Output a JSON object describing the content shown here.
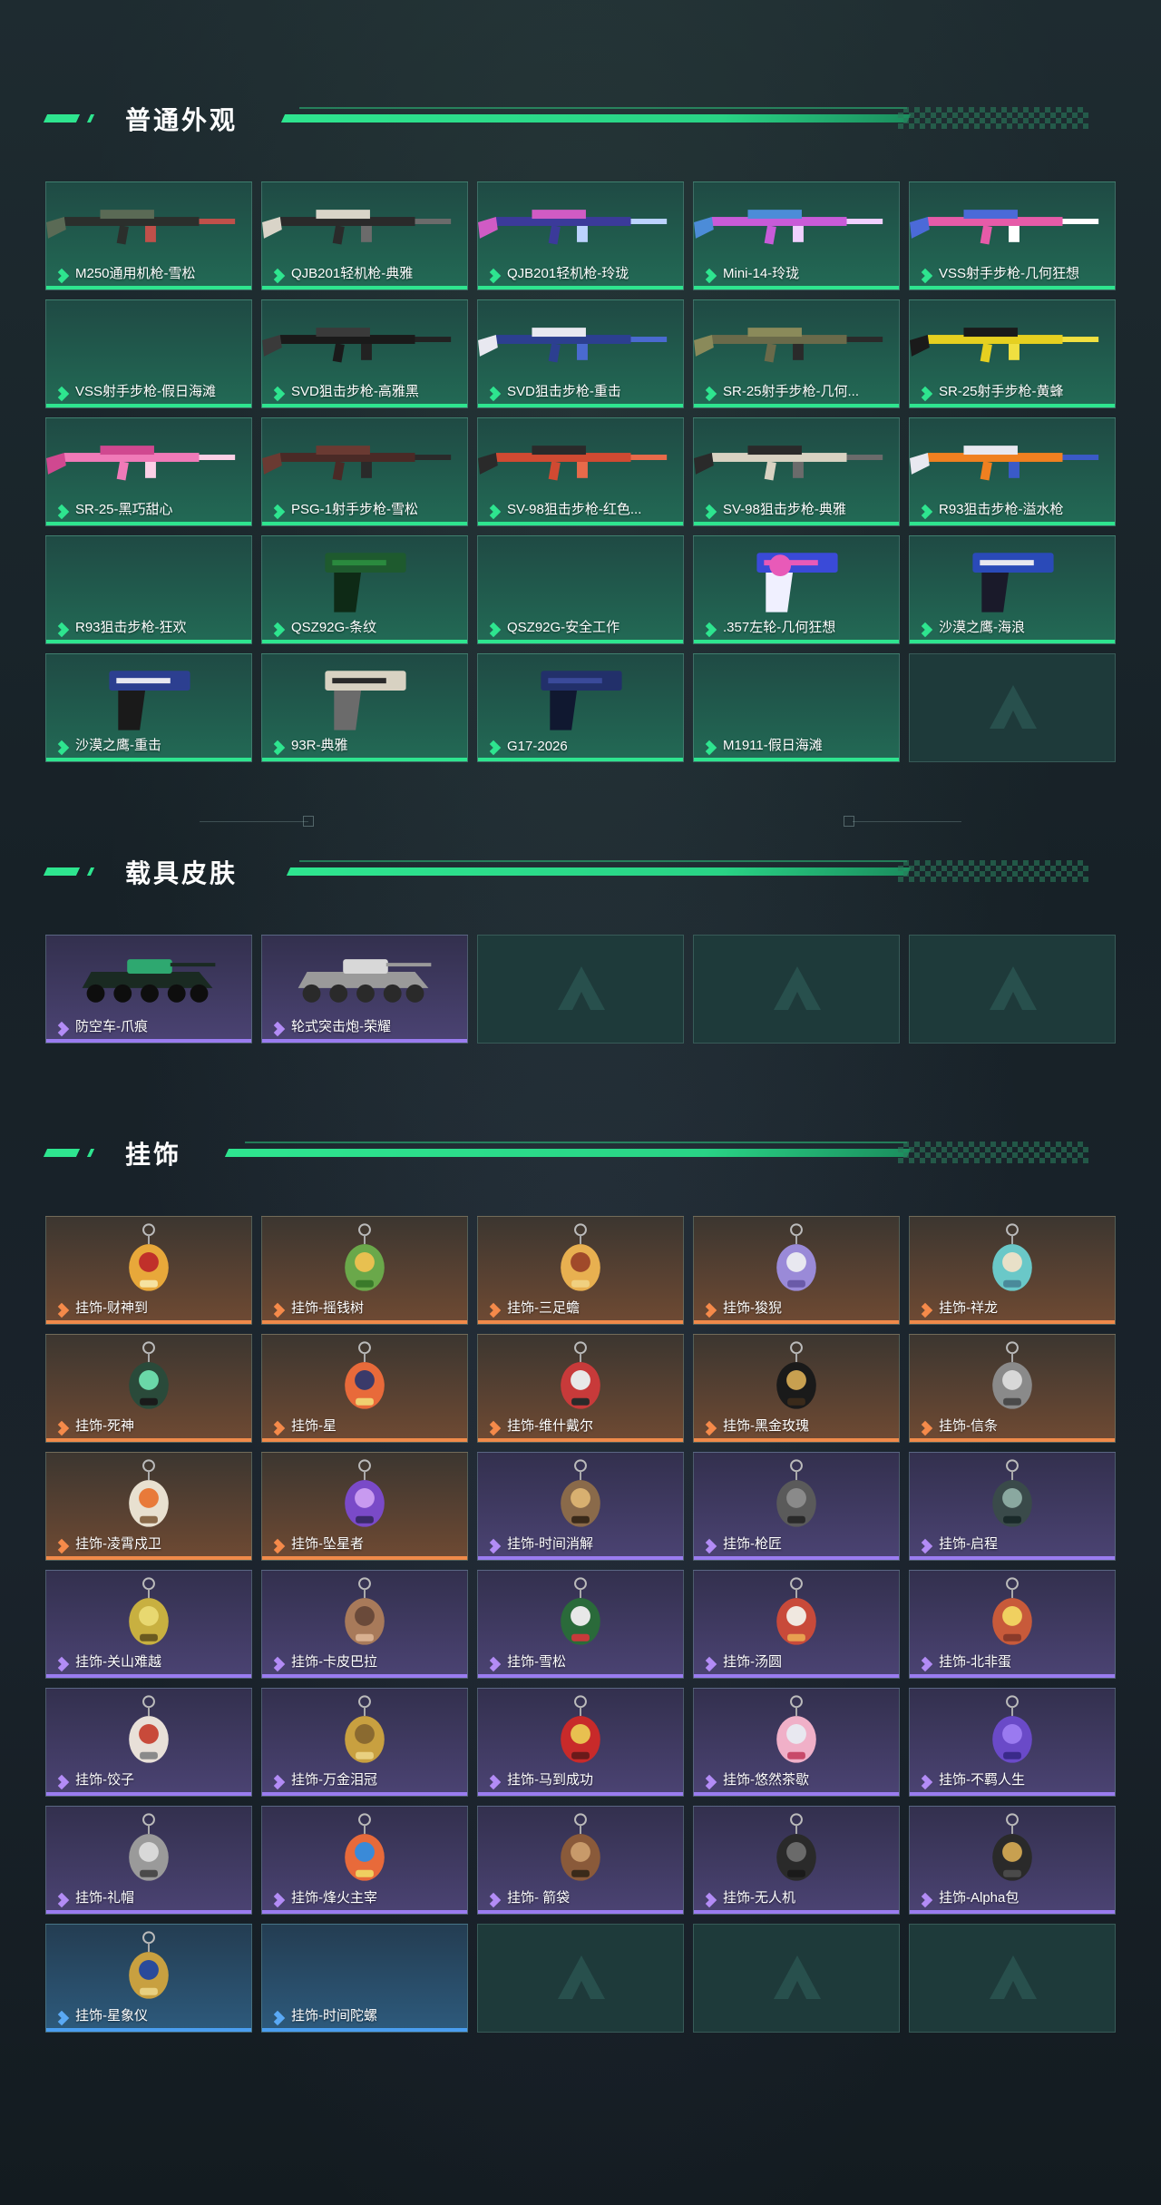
{
  "sections": [
    {
      "title": "普通外观",
      "items": [
        {
          "label": "M250通用机枪-雪松",
          "rarity": "green",
          "art": "rifle",
          "colors": [
            "#2b2f2c",
            "#5a6a55",
            "#c0504a"
          ]
        },
        {
          "label": "QJB201轻机枪-典雅",
          "rarity": "green",
          "art": "rifle",
          "colors": [
            "#2a2a2a",
            "#d9d4c8",
            "#6b6b6b"
          ]
        },
        {
          "label": "QJB201轻机枪-玲珑",
          "rarity": "green",
          "art": "rifle",
          "colors": [
            "#3b3a9a",
            "#d05bc4",
            "#bcd3ff"
          ]
        },
        {
          "label": "Mini-14-玲珑",
          "rarity": "green",
          "art": "rifle",
          "colors": [
            "#c85bd8",
            "#4c8cd8",
            "#f0d0ff"
          ]
        },
        {
          "label": "VSS射手步枪-几何狂想",
          "rarity": "green",
          "art": "rifle",
          "colors": [
            "#e65ba8",
            "#4b6ad8",
            "#ffffff"
          ]
        },
        {
          "label": "VSS射手步枪-假日海滩",
          "rarity": "green",
          "art": "none",
          "colors": [
            "#1f4a44",
            "#1f4a44",
            "#1f4a44"
          ]
        },
        {
          "label": "SVD狙击步枪-高雅黑",
          "rarity": "green",
          "art": "rifle",
          "colors": [
            "#1a1a1a",
            "#3a3a3a",
            "#222"
          ]
        },
        {
          "label": "SVD狙击步枪-重击",
          "rarity": "green",
          "art": "rifle",
          "colors": [
            "#2c3f90",
            "#e8e8f0",
            "#4a6ad0"
          ]
        },
        {
          "label": "SR-25射手步枪-几何...",
          "rarity": "green",
          "art": "rifle",
          "colors": [
            "#6a6a4a",
            "#8a8a5a",
            "#2a2a2a"
          ]
        },
        {
          "label": "SR-25射手步枪-黄蜂",
          "rarity": "green",
          "art": "rifle",
          "colors": [
            "#e6d020",
            "#1a1a1a",
            "#f0e040"
          ]
        },
        {
          "label": "SR-25-黑巧甜心",
          "rarity": "green",
          "art": "rifle",
          "colors": [
            "#f07ab8",
            "#d04890",
            "#fbd0e6"
          ]
        },
        {
          "label": "PSG-1射手步枪-雪松",
          "rarity": "green",
          "art": "rifle",
          "colors": [
            "#4a2a26",
            "#6a3a32",
            "#2a2a2a"
          ]
        },
        {
          "label": "SV-98狙击步枪-红色...",
          "rarity": "green",
          "art": "rifle",
          "colors": [
            "#d04a32",
            "#2a2a2a",
            "#e86a4a"
          ]
        },
        {
          "label": "SV-98狙击步枪-典雅",
          "rarity": "green",
          "art": "rifle",
          "colors": [
            "#d8d2c2",
            "#2a2a2a",
            "#6b6b6b"
          ]
        },
        {
          "label": "R93狙击步枪-溢水枪",
          "rarity": "green",
          "art": "rifle",
          "colors": [
            "#f08020",
            "#e8e8f0",
            "#3a5ac8"
          ]
        },
        {
          "label": "R93狙击步枪-狂欢",
          "rarity": "green",
          "art": "none",
          "colors": [
            "#1f4a44",
            "#1f4a44",
            "#1f4a44"
          ]
        },
        {
          "label": "QSZ92G-条纹",
          "rarity": "green",
          "art": "pistol",
          "colors": [
            "#1e5a2e",
            "#2a8a3e",
            "#0e2a16"
          ]
        },
        {
          "label": "QSZ92G-安全工作",
          "rarity": "green",
          "art": "none",
          "colors": [
            "#1f4a44",
            "#1f4a44",
            "#1f4a44"
          ]
        },
        {
          "label": ".357左轮-几何狂想",
          "rarity": "green",
          "art": "revolver",
          "colors": [
            "#3a4ad8",
            "#e85ab8",
            "#f0f0ff"
          ]
        },
        {
          "label": "沙漠之鹰-海浪",
          "rarity": "green",
          "art": "pistol",
          "colors": [
            "#2a4ab8",
            "#e8e8f0",
            "#1a1a2a"
          ]
        },
        {
          "label": "沙漠之鹰-重击",
          "rarity": "green",
          "art": "pistol",
          "colors": [
            "#2c3f90",
            "#e8e8f0",
            "#1a1a1a"
          ]
        },
        {
          "label": "93R-典雅",
          "rarity": "green",
          "art": "pistol",
          "colors": [
            "#d8d2c2",
            "#2a2a2a",
            "#6b6b6b"
          ]
        },
        {
          "label": "G17-2026",
          "rarity": "green",
          "art": "pistol",
          "colors": [
            "#22306a",
            "#3a4a9a",
            "#101830"
          ]
        },
        {
          "label": "M1911-假日海滩",
          "rarity": "green",
          "art": "none",
          "colors": [
            "#1f4a44",
            "#1f4a44",
            "#1f4a44"
          ]
        },
        {
          "label": "",
          "rarity": "empty",
          "art": "logo",
          "colors": [
            "#3a6a66",
            "#3a6a66",
            "#3a6a66"
          ]
        }
      ]
    },
    {
      "title": "载具皮肤",
      "items": [
        {
          "label": "防空车-爪痕",
          "rarity": "purple",
          "art": "vehicle",
          "colors": [
            "#1a2a22",
            "#2ea870",
            "#0e0e0e"
          ]
        },
        {
          "label": "轮式突击炮-荣耀",
          "rarity": "purple",
          "art": "vehicle",
          "colors": [
            "#9a9a9a",
            "#d8d8d8",
            "#2a2a2a"
          ]
        },
        {
          "label": "",
          "rarity": "empty",
          "art": "logo",
          "colors": [
            "#3a6a66",
            "#3a6a66",
            "#3a6a66"
          ]
        },
        {
          "label": "",
          "rarity": "empty",
          "art": "logo",
          "colors": [
            "#3a6a66",
            "#3a6a66",
            "#3a6a66"
          ]
        },
        {
          "label": "",
          "rarity": "empty",
          "art": "logo",
          "colors": [
            "#3a6a66",
            "#3a6a66",
            "#3a6a66"
          ]
        }
      ]
    },
    {
      "title": "挂饰",
      "items": [
        {
          "label": "挂饰-财神到",
          "rarity": "orange",
          "art": "charm",
          "colors": [
            "#e8a83a",
            "#c0302a",
            "#f6e2a0"
          ]
        },
        {
          "label": "挂饰-摇钱树",
          "rarity": "orange",
          "art": "charm",
          "colors": [
            "#6aa84a",
            "#e8c050",
            "#3a7a2a"
          ]
        },
        {
          "label": "挂饰-三足蟾",
          "rarity": "orange",
          "art": "charm",
          "colors": [
            "#e8b050",
            "#a04a2a",
            "#f0d080"
          ]
        },
        {
          "label": "挂饰-狻猊",
          "rarity": "orange",
          "art": "charm",
          "colors": [
            "#9a8ad8",
            "#e8e8f0",
            "#6a5aa8"
          ]
        },
        {
          "label": "挂饰-祥龙",
          "rarity": "orange",
          "art": "charm",
          "colors": [
            "#6ac8c8",
            "#e8e0c8",
            "#4a8a9a"
          ]
        },
        {
          "label": "挂饰-死神",
          "rarity": "orange",
          "art": "charm",
          "colors": [
            "#2a4a3a",
            "#6ad8a8",
            "#1a1a1a"
          ]
        },
        {
          "label": "挂饰-星",
          "rarity": "orange",
          "art": "charm",
          "colors": [
            "#e86a3a",
            "#3a3a6a",
            "#f0d070"
          ]
        },
        {
          "label": "挂饰-维什戴尔",
          "rarity": "orange",
          "art": "charm",
          "colors": [
            "#c83a3a",
            "#e8e8e8",
            "#2a2a2a"
          ]
        },
        {
          "label": "挂饰-黑金玫瑰",
          "rarity": "orange",
          "art": "charm",
          "colors": [
            "#1a1a1a",
            "#c8a050",
            "#3a2a1a"
          ]
        },
        {
          "label": "挂饰-信条",
          "rarity": "orange",
          "art": "charm",
          "colors": [
            "#8a8a8a",
            "#d8d8d8",
            "#4a4a4a"
          ]
        },
        {
          "label": "挂饰-凌霄戍卫",
          "rarity": "orange",
          "art": "charm",
          "colors": [
            "#e8e0d0",
            "#e87a3a",
            "#8a6a4a"
          ]
        },
        {
          "label": "挂饰-坠星者",
          "rarity": "orange",
          "art": "charm",
          "colors": [
            "#7a4ac8",
            "#c89af0",
            "#3a2a6a"
          ]
        },
        {
          "label": "挂饰-时间消解",
          "rarity": "purple",
          "art": "charm",
          "colors": [
            "#8a6a4a",
            "#d8b070",
            "#3a2a1a"
          ]
        },
        {
          "label": "挂饰-枪匠",
          "rarity": "purple",
          "art": "charm",
          "colors": [
            "#5a5a5a",
            "#8a8a8a",
            "#2a2a2a"
          ]
        },
        {
          "label": "挂饰-启程",
          "rarity": "purple",
          "art": "charm",
          "colors": [
            "#3a4a4a",
            "#8aa8a0",
            "#1a2a2a"
          ]
        },
        {
          "label": "挂饰-关山难越",
          "rarity": "purple",
          "art": "charm",
          "colors": [
            "#c8b040",
            "#e8d870",
            "#6a5a20"
          ]
        },
        {
          "label": "挂饰-卡皮巴拉",
          "rarity": "purple",
          "art": "charm",
          "colors": [
            "#a87a5a",
            "#6a4a3a",
            "#d8b090"
          ]
        },
        {
          "label": "挂饰-雪松",
          "rarity": "purple",
          "art": "charm",
          "colors": [
            "#2a6a3a",
            "#e8e8e8",
            "#c83a3a"
          ]
        },
        {
          "label": "挂饰-汤圆",
          "rarity": "purple",
          "art": "charm",
          "colors": [
            "#c84a3a",
            "#f0e8e0",
            "#e8a050"
          ]
        },
        {
          "label": "挂饰-北非蛋",
          "rarity": "purple",
          "art": "charm",
          "colors": [
            "#c85a3a",
            "#f0d060",
            "#8a3a2a"
          ]
        },
        {
          "label": "挂饰-饺子",
          "rarity": "purple",
          "art": "charm",
          "colors": [
            "#e8e0d8",
            "#c84a3a",
            "#8a8a8a"
          ]
        },
        {
          "label": "挂饰-万金泪冠",
          "rarity": "purple",
          "art": "charm",
          "colors": [
            "#c8a040",
            "#8a6a30",
            "#e8d080"
          ]
        },
        {
          "label": "挂饰-马到成功",
          "rarity": "purple",
          "art": "charm",
          "colors": [
            "#c82a2a",
            "#e8c050",
            "#6a1a1a"
          ]
        },
        {
          "label": "挂饰-悠然茶歇",
          "rarity": "purple",
          "art": "charm",
          "colors": [
            "#f0b0c8",
            "#e8e8f0",
            "#c84a6a"
          ]
        },
        {
          "label": "挂饰-不羁人生",
          "rarity": "purple",
          "art": "charm",
          "colors": [
            "#6a4ac8",
            "#9a7af0",
            "#3a2a8a"
          ]
        },
        {
          "label": "挂饰-礼帽",
          "rarity": "purple",
          "art": "charm",
          "colors": [
            "#9a9a9a",
            "#d8d8d8",
            "#4a4a4a"
          ]
        },
        {
          "label": "挂饰-烽火主宰",
          "rarity": "purple",
          "art": "charm",
          "colors": [
            "#e86a3a",
            "#3a8ad8",
            "#f0d060"
          ]
        },
        {
          "label": "挂饰- 箭袋",
          "rarity": "purple",
          "art": "charm",
          "colors": [
            "#8a5a3a",
            "#c89a6a",
            "#3a2a1a"
          ]
        },
        {
          "label": "挂饰-无人机",
          "rarity": "purple",
          "art": "charm",
          "colors": [
            "#2a2a2a",
            "#6a6a6a",
            "#1a1a1a"
          ]
        },
        {
          "label": "挂饰-Alpha包",
          "rarity": "purple",
          "art": "charm",
          "colors": [
            "#2a2a2a",
            "#c8a050",
            "#4a4a4a"
          ]
        },
        {
          "label": "挂饰-星象仪",
          "rarity": "blue",
          "art": "charm",
          "colors": [
            "#c8a040",
            "#2a4a9a",
            "#e8d080"
          ]
        },
        {
          "label": "挂饰-时间陀螺",
          "rarity": "blue",
          "art": "none",
          "colors": [
            "#2d5a7c",
            "#2d5a7c",
            "#2d5a7c"
          ]
        },
        {
          "label": "",
          "rarity": "empty",
          "art": "logo",
          "colors": [
            "#3a6a66",
            "#3a6a66",
            "#3a6a66"
          ]
        },
        {
          "label": "",
          "rarity": "empty",
          "art": "logo",
          "colors": [
            "#3a6a66",
            "#3a6a66",
            "#3a6a66"
          ]
        },
        {
          "label": "",
          "rarity": "empty",
          "art": "logo",
          "colors": [
            "#3a6a66",
            "#3a6a66",
            "#3a6a66"
          ]
        }
      ]
    }
  ],
  "theme": {
    "accent": "#2ee58f",
    "green_card": "#226a55",
    "purple_card": "#4b4373",
    "orange_card": "#6f4a33",
    "blue_card": "#2d5a7c"
  }
}
